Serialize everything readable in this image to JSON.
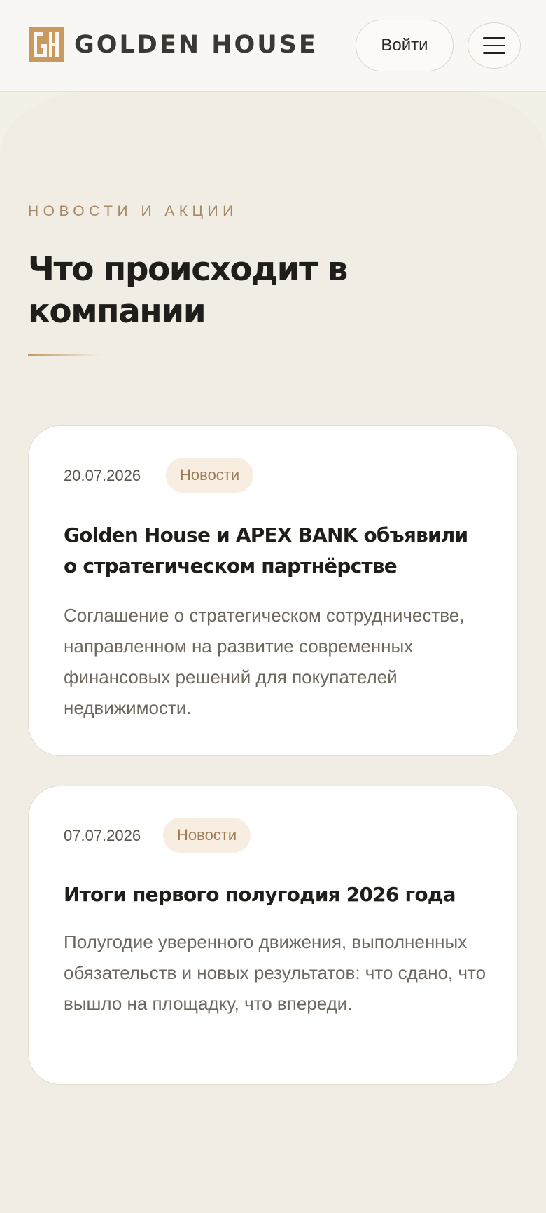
{
  "header": {
    "logo_text": "GOLDEN HOUSE",
    "logo_monogram": "GH",
    "login_label": "Войти",
    "menu_icon": "hamburger-menu-icon"
  },
  "section": {
    "eyebrow": "НОВОСТИ И АКЦИИ",
    "title": "Что происходит в компании"
  },
  "news": [
    {
      "date": "20.07.2026",
      "tag": "Новости",
      "title": "Golden House и APEX BANK объявили о стратегическом партнёрстве",
      "summary": "Соглашение о стратегическом сотрудничестве, направленном на развитие современных финансовых решений для покупателей недвижимости."
    },
    {
      "date": "07.07.2026",
      "tag": "Новости",
      "title": "Итоги первого полугодия 2026 года",
      "summary": "Полугодие уверенного движения, выполненных обязательств и новых результатов: что сдано, что вышло на площадку, что впереди."
    }
  ],
  "colors": {
    "page_background": "#f1ede4",
    "header_background": "#f8f7f3",
    "accent_gold": "#c39a5f",
    "eyebrow": "#a58a66",
    "badge_background": "#f7ede0",
    "badge_text": "#9d7c57",
    "card_background": "#ffffff"
  }
}
